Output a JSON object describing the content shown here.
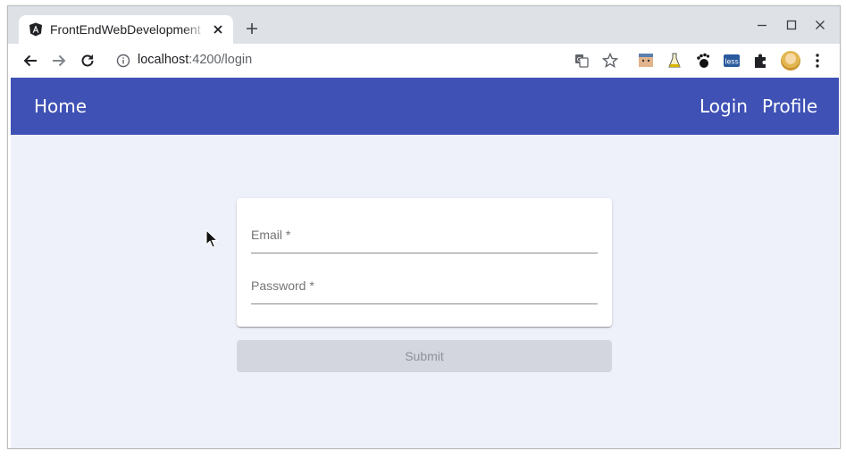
{
  "browser": {
    "tab": {
      "title": "FrontEndWebDevelopment"
    },
    "address_bar": {
      "host": "localhost",
      "path": ":4200/login"
    }
  },
  "app": {
    "nav": {
      "home": "Home",
      "login": "Login",
      "profile": "Profile"
    },
    "colors": {
      "appbar": "#3f51b5",
      "page_background": "#eef0fa",
      "submit_disabled": "#d3d6df"
    }
  },
  "login_form": {
    "email_label": "Email *",
    "email_value": "",
    "password_label": "Password *",
    "password_value": "",
    "submit_label": "Submit",
    "submit_disabled": true
  }
}
